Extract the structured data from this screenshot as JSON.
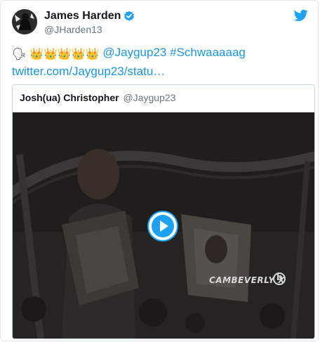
{
  "author": {
    "name": "James Harden",
    "handle": "@JHarden13",
    "verified": true
  },
  "tweet": {
    "emojis": [
      "🗣",
      "👑",
      "👑",
      "👑",
      "👑",
      "👑"
    ],
    "mention": "@Jaygup23",
    "hashtag": "#Schwaaaaag",
    "link": "twitter.com/Jaygup23/statu…"
  },
  "quoted_tweet": {
    "name": "Josh(ua) Christopher",
    "handle": "@Jaygup23",
    "watermark": "CAMBEVERLY X"
  },
  "colors": {
    "link": "#1b95e0",
    "twitter_blue": "#1da1f2",
    "secondary_text": "#657786"
  },
  "icons": {
    "brand": "twitter-bird-icon",
    "verified": "verified-badge-icon",
    "play": "play-icon"
  }
}
